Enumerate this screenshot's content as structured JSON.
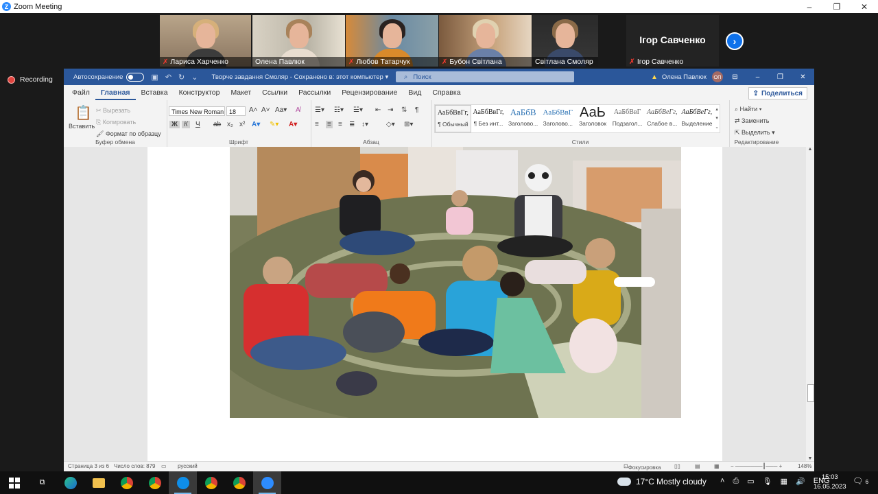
{
  "zoom": {
    "window_title": "Zoom Meeting",
    "participants": [
      {
        "name": "Лариса Харченко",
        "muted": true
      },
      {
        "name": "Олена Павлюк",
        "muted": false
      },
      {
        "name": "Любов Татарчук",
        "muted": true
      },
      {
        "name": "Бубон Світлана",
        "muted": true
      },
      {
        "name": "Світлана Смоляр",
        "muted": false
      }
    ],
    "name_only_tile": {
      "display": "Ігор Савченко",
      "label": "Ігор Савченко",
      "muted": true
    },
    "recording_label": "Recording"
  },
  "word": {
    "autosave_label": "Автосохранение",
    "doc_title": "Творче завдання Смоляр  -  Сохранено в: этот компьютер  ▾",
    "search_placeholder": "Поиск",
    "user_name": "Олена Павлюк",
    "user_initials": "ОП",
    "tabs": [
      "Файл",
      "Главная",
      "Вставка",
      "Конструктор",
      "Макет",
      "Ссылки",
      "Рассылки",
      "Рецензирование",
      "Вид",
      "Справка"
    ],
    "active_tab": "Главная",
    "share_label": "Поделиться",
    "clipboard": {
      "paste": "Вставить",
      "cut": "Вырезать",
      "copy": "Копировать",
      "format_painter": "Формат по образцу",
      "group": "Буфер обмена"
    },
    "font": {
      "name": "Times New Roman",
      "size": "18",
      "group": "Шрифт",
      "bold": "Ж",
      "italic": "К",
      "underline": "Ч"
    },
    "paragraph": {
      "group": "Абзац"
    },
    "styles": {
      "group": "Стили",
      "items": [
        {
          "preview": "АаБбВвГг,",
          "label": "¶ Обычный"
        },
        {
          "preview": "АаБбВвГг,",
          "label": "¶ Без инт..."
        },
        {
          "preview": "АаБбВ",
          "label": "Заголово..."
        },
        {
          "preview": "АаБбВвГ",
          "label": "Заголово..."
        },
        {
          "preview": "АаЬ",
          "label": "Заголовок"
        },
        {
          "preview": "АаБбВвГ",
          "label": "Подзагол..."
        },
        {
          "preview": "АаБбВеГг,",
          "label": "Слабое в..."
        },
        {
          "preview": "АаБбВеГг,",
          "label": "Выделение"
        }
      ]
    },
    "editing": {
      "find": "Найти",
      "replace": "Заменить",
      "select": "Выделить",
      "group": "Редактирование"
    },
    "status": {
      "page": "Страница 3 из 6",
      "words": "Число слов: 879",
      "language": "русский",
      "focus": "Фокусировка",
      "zoom": "148%"
    }
  },
  "taskbar": {
    "weather": "17°C  Mostly cloudy",
    "language": "ENG",
    "time": "15:03",
    "date": "16.05.2023",
    "notifications": "6"
  }
}
